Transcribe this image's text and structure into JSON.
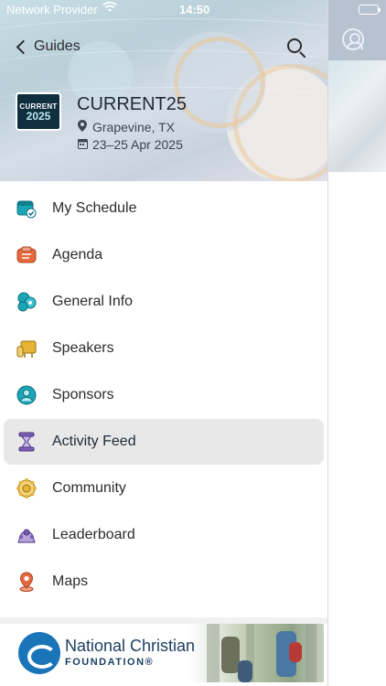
{
  "status_bar": {
    "carrier": "Network Provider",
    "time": "14:50"
  },
  "nav": {
    "back_label": "Guides"
  },
  "event": {
    "logo_line1": "CURRENT",
    "logo_line2": "2025",
    "title": "CURRENT25",
    "location": "Grapevine, TX",
    "dates": "23–25 Apr 2025"
  },
  "menu": [
    {
      "label": "My Schedule",
      "icon": "calendar-check-icon",
      "color": "#1aa6b7",
      "active": false
    },
    {
      "label": "Agenda",
      "icon": "agenda-icon",
      "color": "#e46a3d",
      "active": false
    },
    {
      "label": "General Info",
      "icon": "info-cluster-icon",
      "color": "#1aa6b7",
      "active": false
    },
    {
      "label": "Speakers",
      "icon": "speaker-board-icon",
      "color": "#e7b335",
      "active": false
    },
    {
      "label": "Sponsors",
      "icon": "sponsor-person-icon",
      "color": "#1aa6b7",
      "active": false
    },
    {
      "label": "Activity Feed",
      "icon": "activity-hourglass-icon",
      "color": "#7b5fb5",
      "active": true
    },
    {
      "label": "Community",
      "icon": "community-icon",
      "color": "#e7b335",
      "active": false
    },
    {
      "label": "Leaderboard",
      "icon": "leaderboard-icon",
      "color": "#7b5fb5",
      "active": false
    },
    {
      "label": "Maps",
      "icon": "map-pin-icon",
      "color": "#e46a3d",
      "active": false
    }
  ],
  "sponsor_banner": {
    "name_line1": "National Christian",
    "name_line2": "FOUNDATION®"
  }
}
